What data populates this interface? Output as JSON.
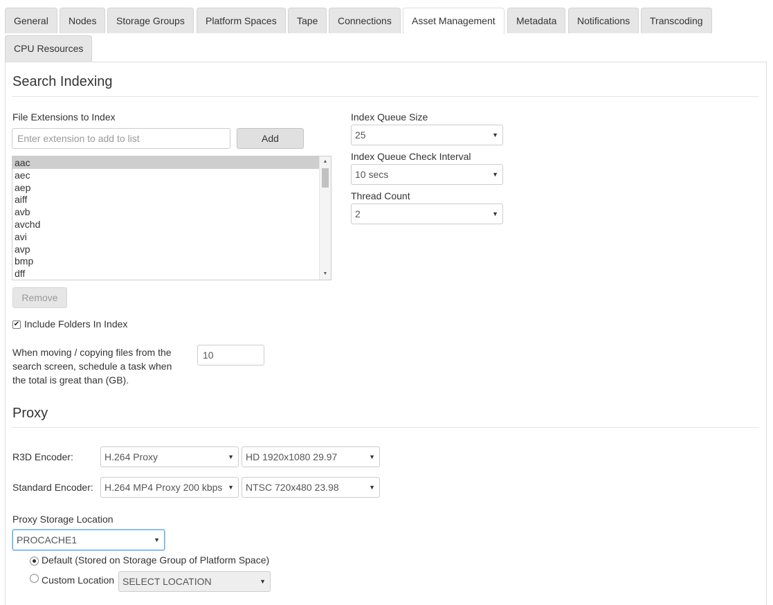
{
  "tabs": [
    {
      "label": "General"
    },
    {
      "label": "Nodes"
    },
    {
      "label": "Storage Groups"
    },
    {
      "label": "Platform Spaces"
    },
    {
      "label": "Tape"
    },
    {
      "label": "Connections"
    },
    {
      "label": "Asset Management",
      "active": true
    },
    {
      "label": "Metadata"
    },
    {
      "label": "Notifications"
    },
    {
      "label": "Transcoding"
    },
    {
      "label": "CPU Resources"
    }
  ],
  "search_indexing": {
    "title": "Search Indexing",
    "file_extensions_label": "File Extensions to Index",
    "extension_placeholder": "Enter extension to add to list",
    "add_label": "Add",
    "extensions": [
      "aac",
      "aec",
      "aep",
      "aiff",
      "avb",
      "avchd",
      "avi",
      "avp",
      "bmp",
      "dff"
    ],
    "selected_extension": "aac",
    "remove_label": "Remove",
    "include_folders_label": "Include Folders In Index",
    "include_folders_checked": true,
    "move_copy_label_line1": "When moving / copying files from the",
    "move_copy_label_line2": "search screen, schedule a task when",
    "move_copy_label_line3": "the total is great than (GB).",
    "move_copy_value": "10",
    "index_queue_size_label": "Index Queue Size",
    "index_queue_size_value": "25",
    "index_queue_check_interval_label": "Index Queue Check Interval",
    "index_queue_check_interval_value": "10 secs",
    "thread_count_label": "Thread Count",
    "thread_count_value": "2"
  },
  "proxy": {
    "title": "Proxy",
    "r3d_encoder_label": "R3D Encoder:",
    "r3d_encoder_value": "H.264 Proxy",
    "r3d_resolution_value": "HD 1920x1080 29.97",
    "standard_encoder_label": "Standard Encoder:",
    "standard_encoder_value": "H.264 MP4 Proxy 200 kbps",
    "standard_resolution_value": "NTSC 720x480 23.98",
    "storage_location_label": "Proxy Storage Location",
    "storage_location_value": "PROCACHE1",
    "default_option_label": "Default (Stored on Storage Group of Platform Space)",
    "default_option_checked": true,
    "custom_option_label": "Custom Location",
    "custom_option_checked": false,
    "custom_location_value": "SELECT LOCATION"
  },
  "icons": {
    "dropdown_arrow": "▼",
    "checkmark": "✔",
    "scroll_up": "▲",
    "scroll_down": "▼"
  }
}
